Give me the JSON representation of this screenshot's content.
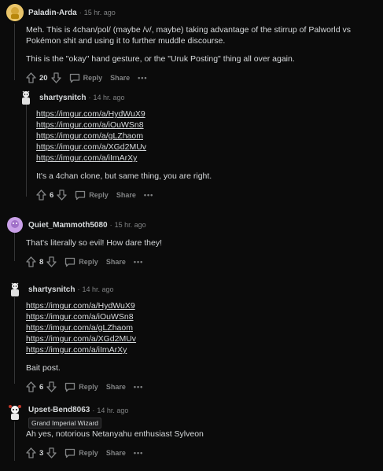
{
  "c1": {
    "author": "Paladin-Arda",
    "time": "15 hr. ago",
    "lines": [
      "Meh. This is 4chan/pol/ (maybe /v/, maybe) taking advantage of the stirrup of Palworld vs Pokémon shit and using it to further muddle discourse.",
      "This is the \"okay\" hand gesture, or the \"Uruk Posting\" thing all over again."
    ],
    "votes": "20",
    "reply": "Reply",
    "share": "Share",
    "more": "•••"
  },
  "c2": {
    "author": "shartysnitch",
    "time": "14 hr. ago",
    "links": [
      "https://imgur.com/a/HydWuX9",
      "https://imgur.com/a/iOuWSn8",
      "https://imgur.com/a/gLZhaom",
      "https://imgur.com/a/XGd2MUv",
      "https://imgur.com/a/iImArXy"
    ],
    "text": "It's a 4chan clone, but same thing, you are right.",
    "votes": "6",
    "reply": "Reply",
    "share": "Share",
    "more": "•••"
  },
  "c3": {
    "author": "Quiet_Mammoth5080",
    "time": "15 hr. ago",
    "text": "That's literally so evil! How dare they!",
    "votes": "8",
    "reply": "Reply",
    "share": "Share",
    "more": "•••"
  },
  "c4": {
    "author": "shartysnitch",
    "time": "14 hr. ago",
    "links": [
      "https://imgur.com/a/HydWuX9",
      "https://imgur.com/a/iOuWSn8",
      "https://imgur.com/a/gLZhaom",
      "https://imgur.com/a/XGd2MUv",
      "https://imgur.com/a/iImArXy"
    ],
    "text": "Bait post.",
    "votes": "6",
    "reply": "Reply",
    "share": "Share",
    "more": "•••"
  },
  "c5": {
    "author": "Upset-Bend8063",
    "time": "14 hr. ago",
    "flair": "Grand Imperial Wizard",
    "text": "Ah yes, notorious Netanyahu enthusiast Sylveon",
    "votes": "3",
    "reply": "Reply",
    "share": "Share",
    "more": "•••"
  },
  "colors": {
    "background": "#0b0b0b",
    "text": "#d7dadc",
    "muted": "#818384",
    "line": "#343536"
  },
  "icons": [
    "upvote-icon",
    "downvote-icon",
    "comment-icon",
    "overflow-icon"
  ]
}
